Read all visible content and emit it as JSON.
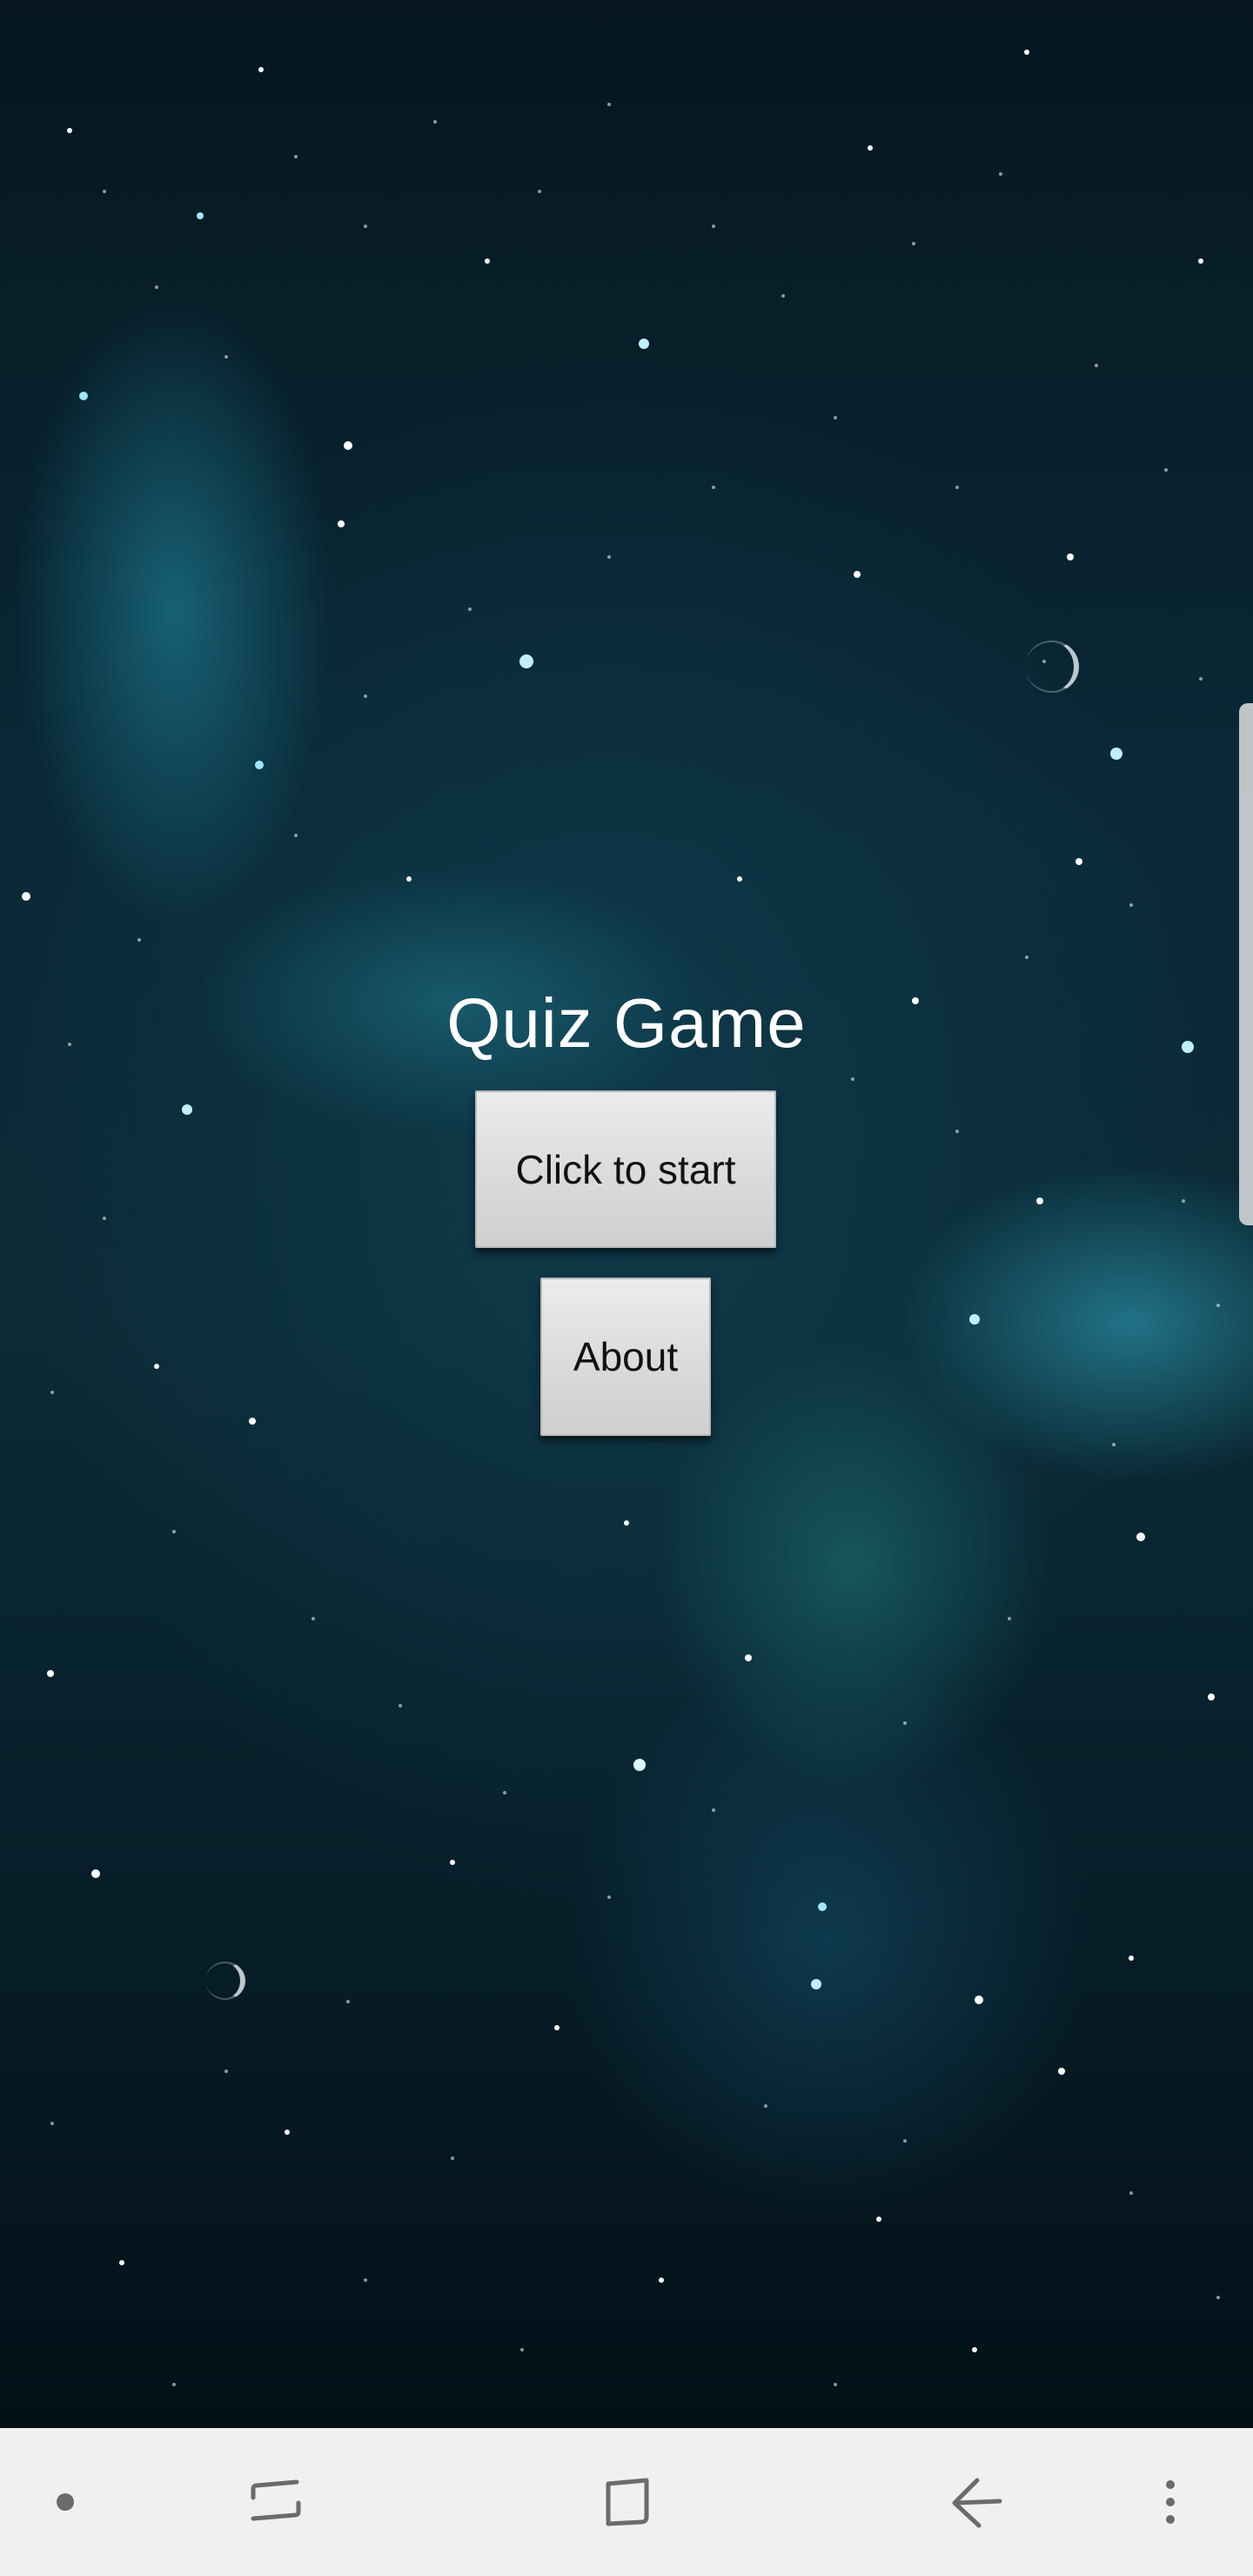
{
  "app": {
    "title": "Quiz Game"
  },
  "menu": {
    "start_label": "Click to start",
    "about_label": "About"
  },
  "navigation_bar": {
    "background_color": "#f0f0f0",
    "icon_color": "#6b6b6b",
    "items": [
      {
        "icon": "dot-indicator-icon"
      },
      {
        "icon": "recent-apps-icon"
      },
      {
        "icon": "home-icon"
      },
      {
        "icon": "back-arrow-icon"
      },
      {
        "icon": "more-options-icon"
      }
    ]
  },
  "colors": {
    "title_text": "#ffffff",
    "button_face": "#dcdcdc",
    "button_text": "#111111",
    "background_base": "#0a2a38"
  }
}
